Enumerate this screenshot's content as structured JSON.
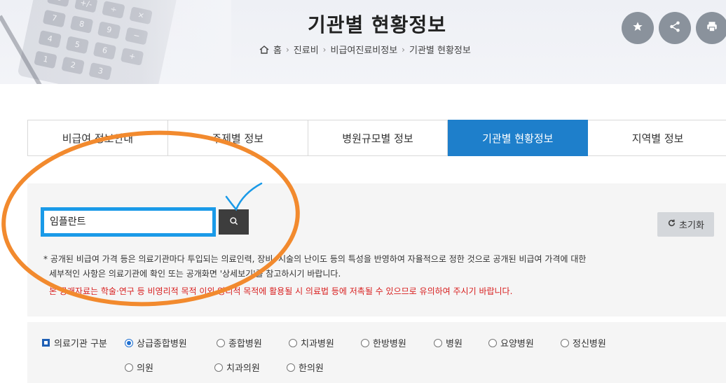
{
  "header": {
    "title": "기관별 현황정보",
    "breadcrumb": [
      "홈",
      "진료비",
      "비급여진료비정보",
      "기관별 현황정보"
    ],
    "actions": [
      "star-icon",
      "share-icon",
      "print-icon"
    ],
    "calculator_keys": [
      "C",
      "+/-",
      "÷",
      "×",
      "7",
      "8",
      "9",
      "−",
      "4",
      "5",
      "6",
      "+",
      "1",
      "2",
      "3"
    ]
  },
  "tabs": [
    "비급여 정보안내",
    "주제별 정보",
    "병원규모별 정보",
    "기관별 현황정보",
    "지역별 정보"
  ],
  "active_tab": 3,
  "search": {
    "value": "임플란트",
    "reset_label": "초기화"
  },
  "notice": {
    "line1": "* 공개된 비급여 가격 등은 의료기관마다 투입되는 의료인력, 장비, 시술의 난이도 등의 특성을 반영하여 자율적으로 정한 것으로 공개된 비급여 가격에 대한",
    "line2": "세부적인 사항은 의료기관에 확인 또는 공개화면 '상세보기'를 참고하시기 바랍니다.",
    "warning": "본 공개자료는 학술·연구 등 비영리적 목적 이외 영리적 목적에 활용될 시 의료법 등에 저촉될 수 있으므로 유의하여 주시기 바랍니다."
  },
  "filter": {
    "label": "의료기관 구분",
    "options": [
      "상급종합병원",
      "종합병원",
      "치과병원",
      "한방병원",
      "병원",
      "요양병원",
      "정신병원",
      "의원",
      "치과의원",
      "한의원"
    ],
    "selected": 0
  },
  "colors": {
    "active_tab": "#1e7fcb",
    "search_border": "#1a9ae8",
    "annotation": "#f28a2e",
    "warning": "#d81e1e"
  }
}
